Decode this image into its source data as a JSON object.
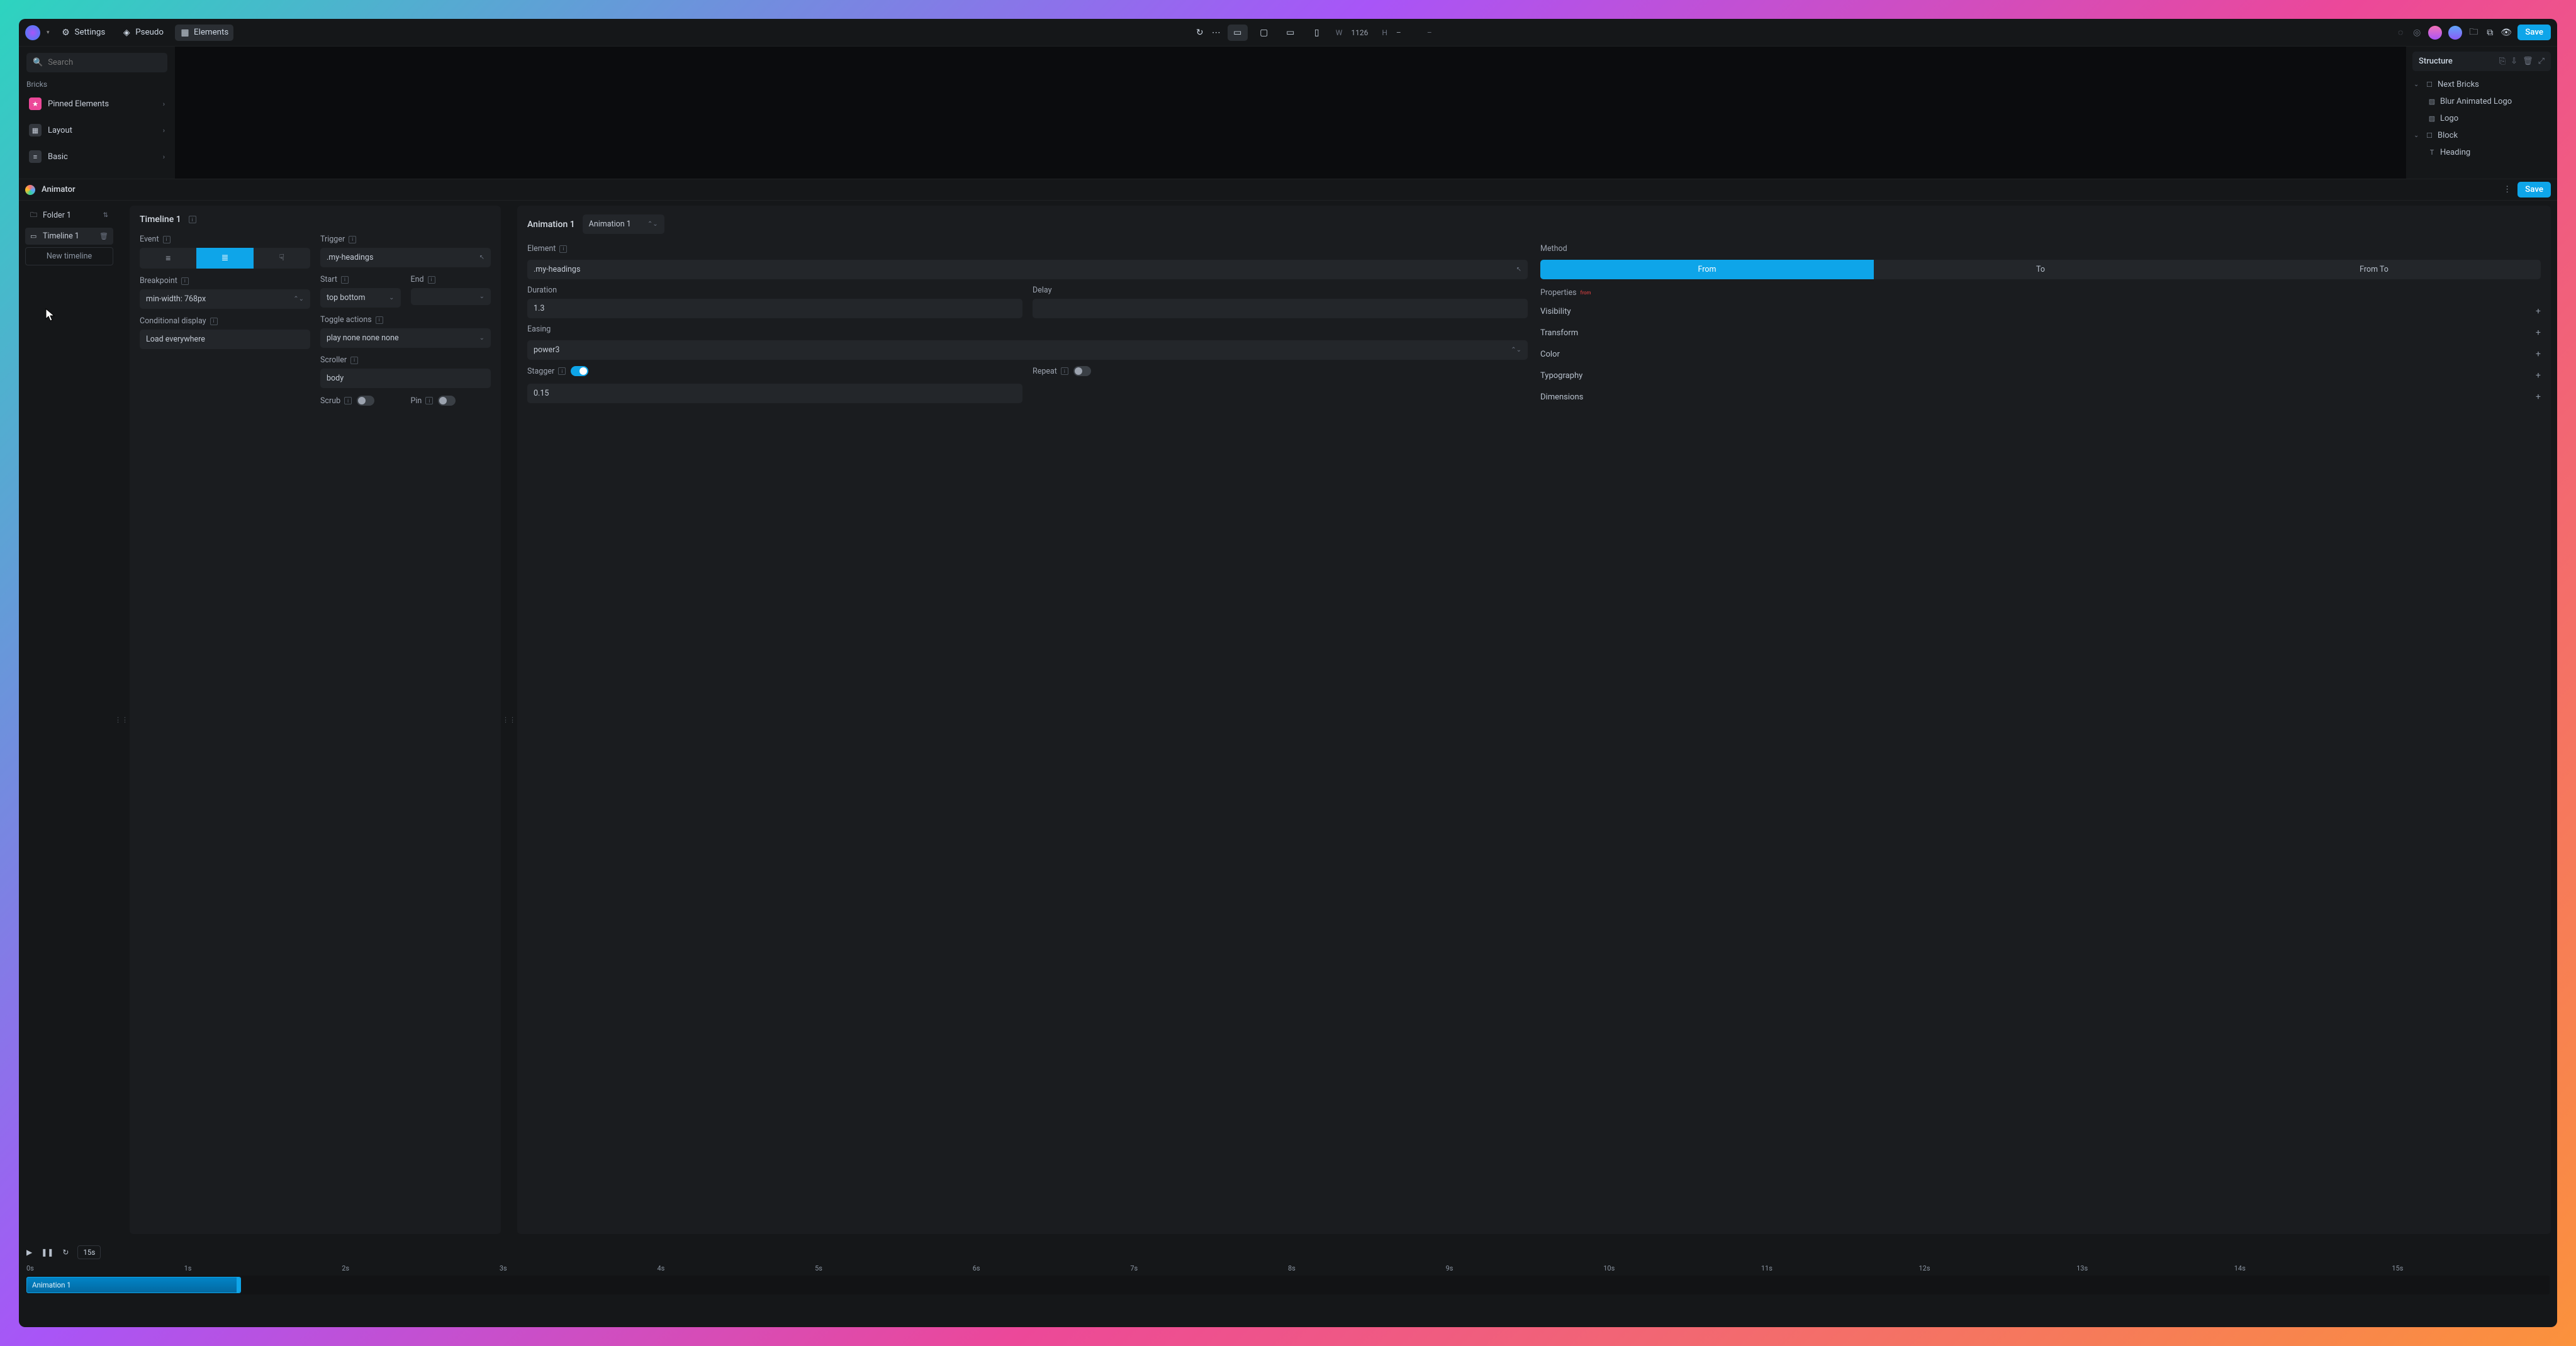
{
  "toolbar": {
    "settings": "Settings",
    "pseudo": "Pseudo",
    "elements": "Elements",
    "width_lbl": "W",
    "width_val": "1126",
    "height_lbl": "H",
    "height_val": "–",
    "save": "Save"
  },
  "left": {
    "search_ph": "Search",
    "section": "Bricks",
    "cats": [
      {
        "label": "Pinned Elements",
        "color": "#ec4899"
      },
      {
        "label": "Layout",
        "color": "#3b3f46"
      },
      {
        "label": "Basic",
        "color": "#3b3f46"
      }
    ]
  },
  "structure": {
    "title": "Structure",
    "tree": [
      {
        "label": "Next Bricks",
        "icon": "☐",
        "chev": "⌄",
        "indent": 0
      },
      {
        "label": "Blur Animated Logo",
        "icon": "▨",
        "indent": 1
      },
      {
        "label": "Logo",
        "icon": "▨",
        "indent": 1
      },
      {
        "label": "Block",
        "icon": "☐",
        "chev": "⌄",
        "indent": 0
      },
      {
        "label": "Heading",
        "icon": "T",
        "indent": 1
      }
    ]
  },
  "animator": {
    "title": "Animator",
    "save": "Save",
    "folder": "Folder 1",
    "timelines": [
      "Timeline 1"
    ],
    "new_tl": "New timeline"
  },
  "timeline": {
    "title": "Timeline 1",
    "event_lbl": "Event",
    "trigger_lbl": "Trigger",
    "trigger_val": ".my-headings",
    "breakpoint_lbl": "Breakpoint",
    "breakpoint_val": "min-width: 768px",
    "start_lbl": "Start",
    "start_val": "top bottom",
    "end_lbl": "End",
    "end_val": "",
    "cond_lbl": "Conditional display",
    "cond_val": "Load everywhere",
    "toggle_lbl": "Toggle actions",
    "toggle_val": "play none none none",
    "scroller_lbl": "Scroller",
    "scroller_val": "body",
    "scrub_lbl": "Scrub",
    "pin_lbl": "Pin"
  },
  "animation": {
    "title": "Animation 1",
    "select": "Animation 1",
    "element_lbl": "Element",
    "element_val": ".my-headings",
    "method_lbl": "Method",
    "methods": [
      "From",
      "To",
      "From To"
    ],
    "duration_lbl": "Duration",
    "duration_val": "1.3",
    "delay_lbl": "Delay",
    "delay_val": "",
    "easing_lbl": "Easing",
    "easing_val": "power3",
    "stagger_lbl": "Stagger",
    "stagger_val": "0.15",
    "repeat_lbl": "Repeat",
    "props_lbl": "Properties",
    "props_badge": "from",
    "props": [
      "Visibility",
      "Transform",
      "Color",
      "Typography",
      "Dimensions"
    ]
  },
  "tl_footer": {
    "duration": "15s",
    "ticks": [
      "0s",
      "1s",
      "2s",
      "3s",
      "4s",
      "5s",
      "6s",
      "7s",
      "8s",
      "9s",
      "10s",
      "11s",
      "12s",
      "13s",
      "14s",
      "15s"
    ],
    "clip": "Animation 1"
  }
}
